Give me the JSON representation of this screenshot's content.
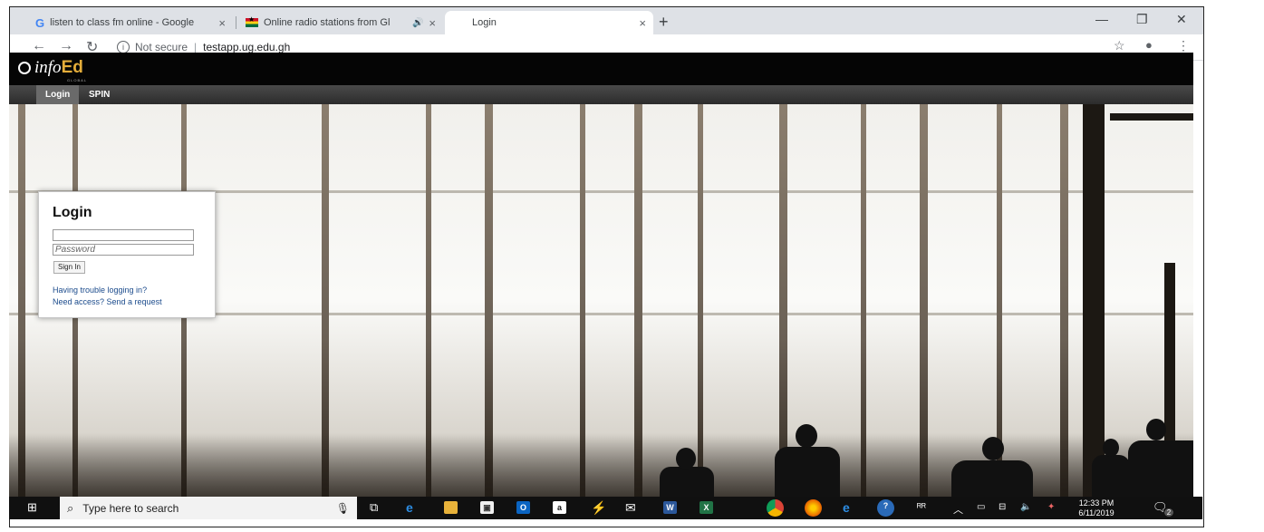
{
  "browser": {
    "tabs": [
      {
        "title": "listen to class fm online - Google",
        "icon": "google-icon"
      },
      {
        "title": "Online radio stations from Gl",
        "icon": "ghana-flag-icon",
        "audio": true
      },
      {
        "title": "Login",
        "active": true
      }
    ],
    "new_tab": "+",
    "security_label": "Not secure",
    "url": "testapp.ug.edu.gh"
  },
  "site": {
    "logo_text": "info",
    "logo_accent": "Ed",
    "logo_sub": "GLOBAL",
    "nav": [
      {
        "label": "Login",
        "active": true
      },
      {
        "label": "SPIN"
      }
    ]
  },
  "login": {
    "title": "Login",
    "username_value": "",
    "password_placeholder": "Password",
    "sign_in_label": "Sign In",
    "trouble_link": "Having trouble logging in?",
    "access_link": "Need access? Send a request"
  },
  "taskbar": {
    "search_placeholder": "Type here to search",
    "time": "12:33 PM",
    "date": "6/11/2019",
    "notification_count": "2"
  },
  "colors": {
    "header_bg": "#050505",
    "logo_accent": "#e4ad3a",
    "link": "#1b4b8c",
    "taskbar": "#101010"
  }
}
